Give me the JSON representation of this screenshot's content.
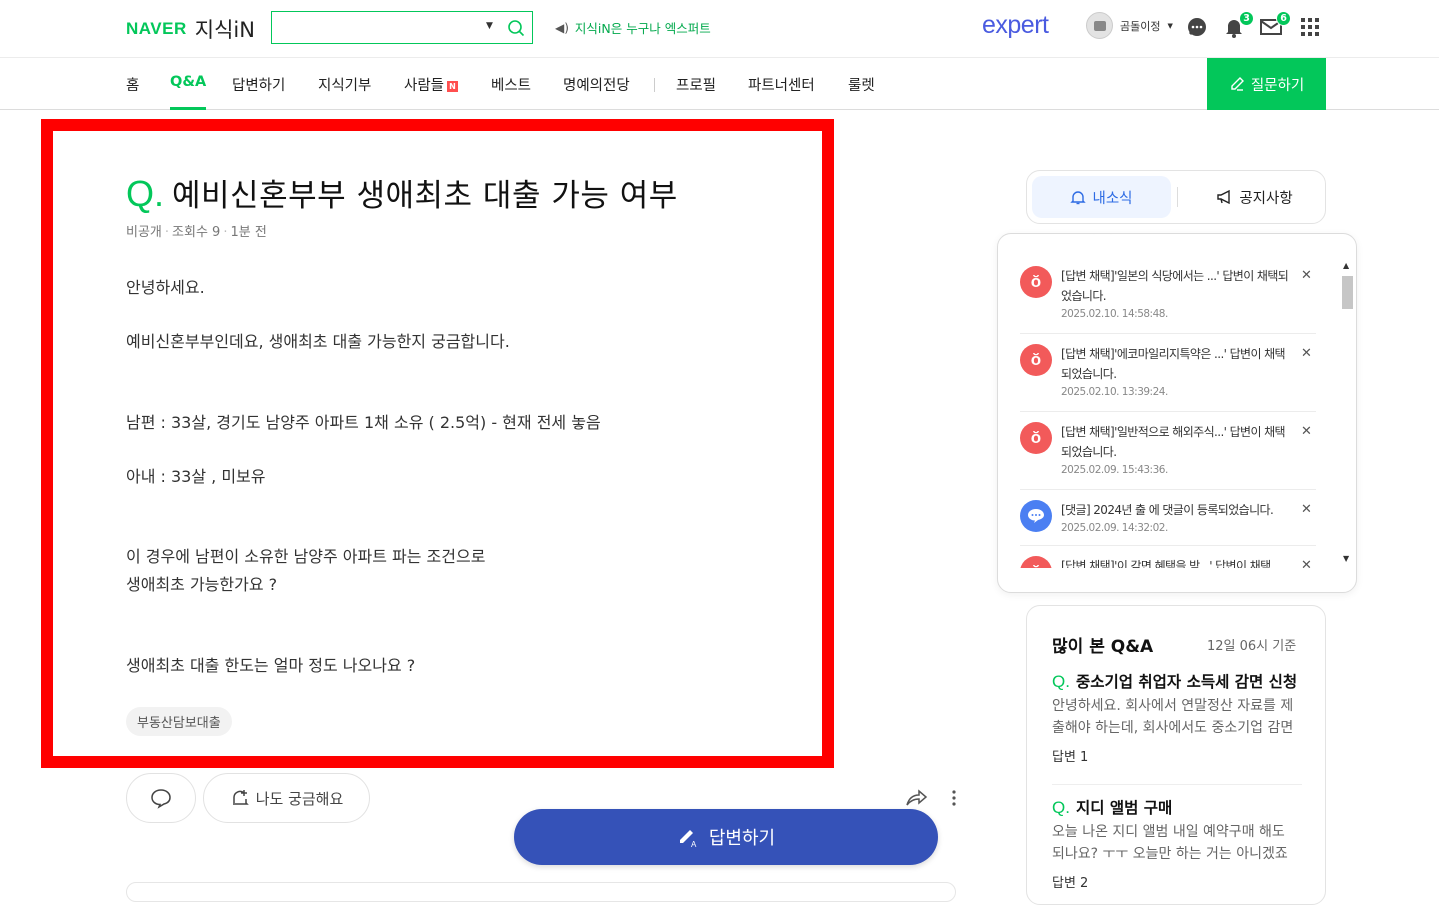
{
  "header": {
    "brand": "NAVER",
    "service": "지식iN",
    "search_placeholder": "",
    "promo": "지식iN은 누구나 엑스퍼트",
    "expert_logo": "expert",
    "user_name": "곰돌이정",
    "notif_count": "3",
    "mail_count": "6"
  },
  "nav": {
    "items": [
      "홈",
      "Q&A",
      "답변하기",
      "지식기부",
      "사람들",
      "베스트",
      "명예의전당",
      "프로필",
      "파트너센터",
      "룰렛"
    ],
    "new_badge": "N",
    "ask_button": "질문하기"
  },
  "question": {
    "q_mark": "Q.",
    "title": "예비신혼부부 생애최초 대출 가능 여부",
    "author": "비공개",
    "views": "조회수 9",
    "time": "1분 전",
    "lines": [
      "안녕하세요.",
      "예비신혼부부인데요, 생애최초 대출 가능한지 궁금합니다.",
      "남편 : 33살, 경기도 남양주 아파트 1채 소유 ( 2.5억) - 현재 전세 놓음",
      "아내 : 33살 , 미보유",
      "이 경우에 남편이 소유한 남양주 아파트 파는 조건으로",
      "생애최초 가능한가요 ?",
      "생애최초 대출 한도는 얼마 정도 나오나요 ?"
    ],
    "tag": "부동산담보대출"
  },
  "actions": {
    "curious": "나도 궁금해요",
    "answer": "답변하기"
  },
  "side": {
    "tab_news": "내소식",
    "tab_notice": "공지사항",
    "notifications": [
      {
        "text": "[답변 채택]'일본의 식당에서는 ...' 답변이 채택되었습니다.",
        "date": "2025.02.10. 14:58:48.",
        "type": "adopt"
      },
      {
        "text": "[답변 채택]'에코마일리지특약은 ...' 답변이 채택되었습니다.",
        "date": "2025.02.10. 13:39:24.",
        "type": "adopt"
      },
      {
        "text": "[답변 채택]'일반적으로 해외주식...' 답변이 채택되었습니다.",
        "date": "2025.02.09. 15:43:36.",
        "type": "adopt"
      },
      {
        "text": "[댓글] 2024년 출 에 댓글이 등록되었습니다.",
        "date": "2025.02.09. 14:32:02.",
        "type": "comment"
      },
      {
        "text": "[답변 채택]'이 감면 혜택을 받...' 답변이 채택",
        "date": "",
        "type": "adopt"
      }
    ],
    "popular": {
      "title": "많이 본 Q&A",
      "time": "12일 06시 기준",
      "items": [
        {
          "q": "Q.",
          "title": "중소기업 취업자 소득세 감면 신청",
          "desc": "안녕하세요. 회사에서 연말정산 자료를 제출해야 하는데, 회사에서도 중소기업 감면 신청서를",
          "answers": "답변 1"
        },
        {
          "q": "Q.",
          "title": "지디 앨범 구매",
          "desc": "오늘 나온 지디 앨범 내일 예약구매 해도 되나요? ㅜㅜ 오늘만 하는 거는 아니겠죠",
          "answers": "답변 2"
        }
      ]
    }
  },
  "colors": {
    "brand_green": "#03c75a",
    "answer_blue": "#3552b8",
    "highlight_red": "#ff0000",
    "expert_blue": "#4a5be0"
  }
}
